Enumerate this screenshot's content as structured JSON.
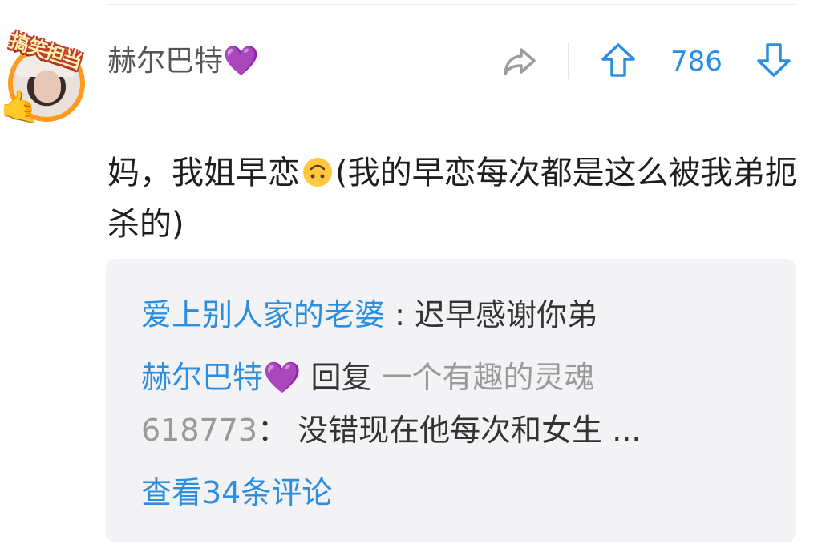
{
  "comment": {
    "avatar_badge": "搞笑担当",
    "username": "赫尔巴特",
    "username_suffix": "💜",
    "vote_count": "786",
    "text_before_emoji": "妈，我姐早恋",
    "text_after_emoji": "(我的早恋每次都是这么被我弟扼杀的)"
  },
  "replies": [
    {
      "author": "爱上别人家的老婆",
      "separator": " : ",
      "text": "迟早感谢你弟"
    },
    {
      "author": "赫尔巴特",
      "author_suffix": "💜",
      "reply_word": "回复",
      "target_line1": "一个有趣的灵魂",
      "target_line2": "618773",
      "separator": "：",
      "text": "没错现在他每次和女生 ..."
    }
  ],
  "view_more": "查看34条评论",
  "colors": {
    "accent_blue": "#2b8ee0",
    "heart_purple": "#8e2ec9",
    "reply_bg": "#f3f3f5",
    "badge_orange": "#ff9a1a"
  },
  "icons": [
    "share-icon",
    "upvote-icon",
    "downvote-icon",
    "upside-down-face-emoji",
    "hand-icon"
  ]
}
